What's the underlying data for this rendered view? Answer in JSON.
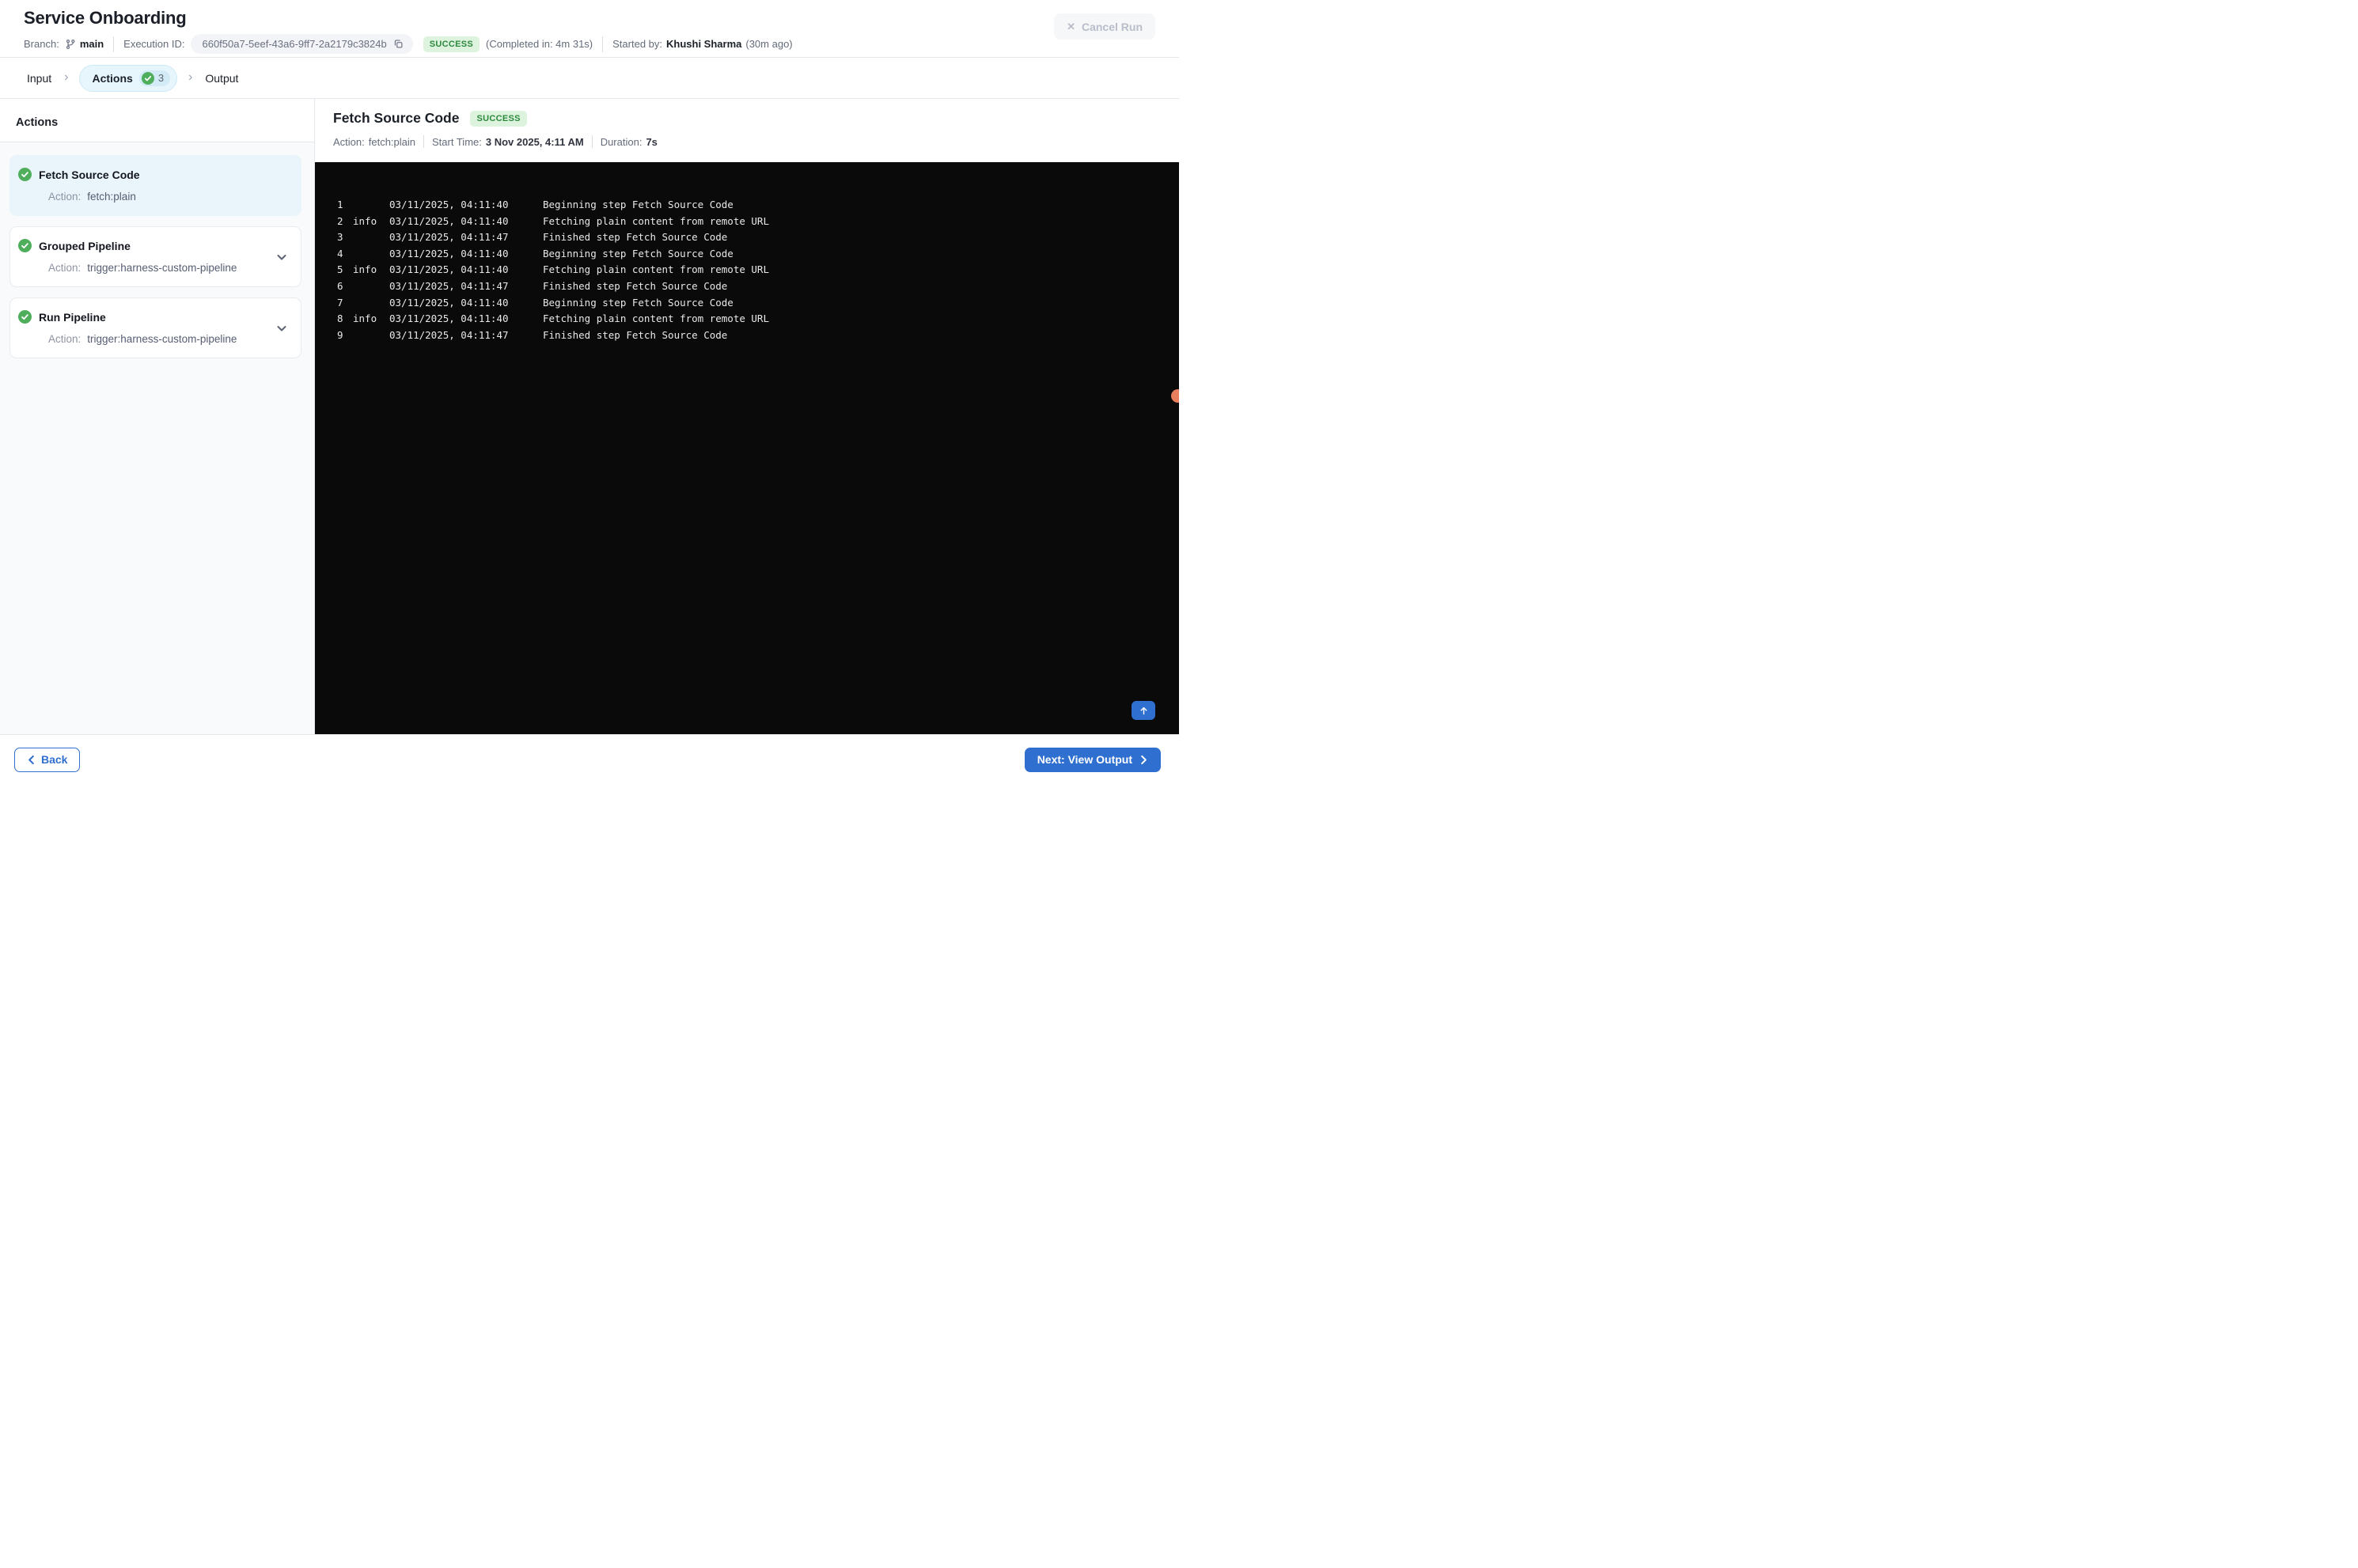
{
  "header": {
    "title": "Service Onboarding",
    "branch_label": "Branch:",
    "branch": "main",
    "execution_id_label": "Execution ID:",
    "execution_id": "660f50a7-5eef-43a6-9ff7-2a2179c3824b",
    "status": "SUCCESS",
    "completed_in": "(Completed in: 4m 31s)",
    "started_by_label": "Started by:",
    "started_by": "Khushi Sharma",
    "started_ago": "(30m ago)",
    "cancel_button": "Cancel Run"
  },
  "tabs": {
    "input": "Input",
    "actions": "Actions",
    "actions_count": "3",
    "output": "Output"
  },
  "sidebar": {
    "heading": "Actions",
    "action_label": "Action:",
    "items": [
      {
        "title": "Fetch Source Code",
        "action": "fetch:plain",
        "status": "success",
        "selected": true,
        "expandable": false
      },
      {
        "title": "Grouped Pipeline",
        "action": "trigger:harness-custom-pipeline",
        "status": "success",
        "selected": false,
        "expandable": true
      },
      {
        "title": "Run Pipeline",
        "action": "trigger:harness-custom-pipeline",
        "status": "success",
        "selected": false,
        "expandable": true
      }
    ]
  },
  "detail": {
    "title": "Fetch Source Code",
    "status": "SUCCESS",
    "action_label": "Action:",
    "action_value": "fetch:plain",
    "start_label": "Start Time:",
    "start_value": "3 Nov 2025, 4:11 AM",
    "duration_label": "Duration:",
    "duration_value": "7s"
  },
  "log": {
    "lines": [
      {
        "num": "1",
        "level": "",
        "time": "03/11/2025, 04:11:40",
        "msg": "Beginning step Fetch Source Code"
      },
      {
        "num": "2",
        "level": "info",
        "time": "03/11/2025, 04:11:40",
        "msg": "Fetching plain content from remote URL"
      },
      {
        "num": "3",
        "level": "",
        "time": "03/11/2025, 04:11:47",
        "msg": "Finished step Fetch Source Code"
      },
      {
        "num": "4",
        "level": "",
        "time": "03/11/2025, 04:11:40",
        "msg": "Beginning step Fetch Source Code"
      },
      {
        "num": "5",
        "level": "info",
        "time": "03/11/2025, 04:11:40",
        "msg": "Fetching plain content from remote URL"
      },
      {
        "num": "6",
        "level": "",
        "time": "03/11/2025, 04:11:47",
        "msg": "Finished step Fetch Source Code"
      },
      {
        "num": "7",
        "level": "",
        "time": "03/11/2025, 04:11:40",
        "msg": "Beginning step Fetch Source Code"
      },
      {
        "num": "8",
        "level": "info",
        "time": "03/11/2025, 04:11:40",
        "msg": "Fetching plain content from remote URL"
      },
      {
        "num": "9",
        "level": "",
        "time": "03/11/2025, 04:11:47",
        "msg": "Finished step Fetch Source Code"
      }
    ]
  },
  "footer": {
    "back": "Back",
    "next": "Next: View Output"
  },
  "colors": {
    "accent_blue": "#2e6fd0",
    "success_bg": "#ddf3de",
    "success_text": "#2c8a3d",
    "check_green": "#4fae5c",
    "console_bg": "#0a0a0b",
    "console_text": "#e8e8e8",
    "selected_card_bg": "#e9f4fb",
    "tab_pill_bg": "#e7f6fd",
    "tab_pill_border": "#cfe9f6",
    "count_pill_bg": "#d3ebf7",
    "orange_dot": "#e87f5c",
    "sidebar_bg": "#f8fafc",
    "border": "#e5e7ec",
    "text_dark": "#1b1f27",
    "text_gray": "#646b7a",
    "disabled_text": "#b9bdc9",
    "disabled_bg": "#f6f7f9"
  }
}
